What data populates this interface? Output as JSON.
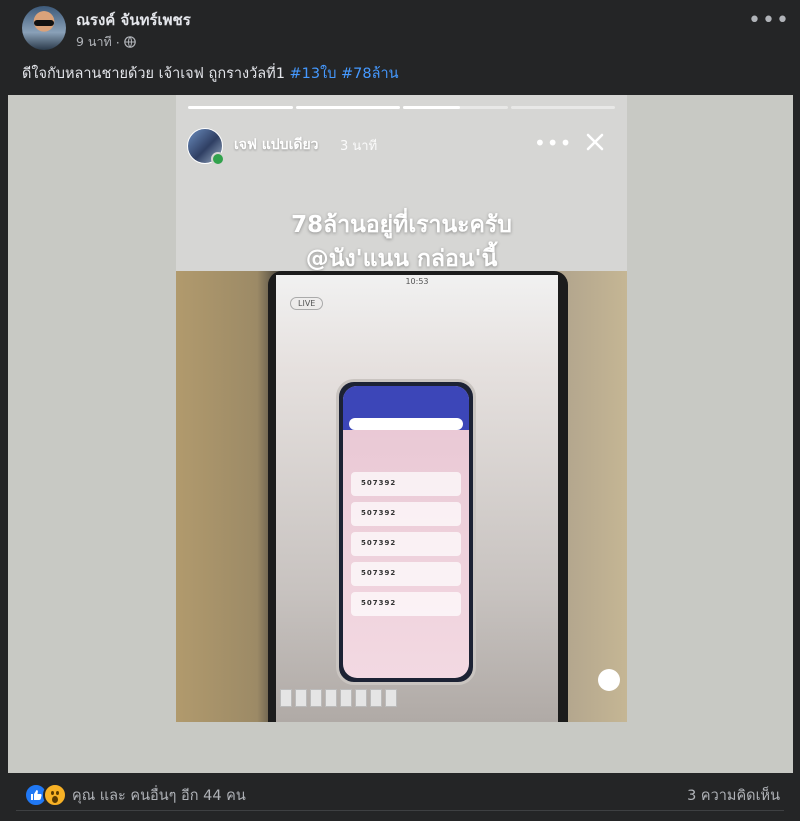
{
  "post": {
    "author": "ณรงค์ จันทร์เพชร",
    "time": "9 นาที",
    "separator": "·",
    "caption_text": "ดีใจกับหลานชายด้วย เจ้าเจฟ ถูกรางวัลที่1 ",
    "hashtags": [
      "#13ใบ",
      "#78ล้าน"
    ],
    "more_glyph": "•••"
  },
  "story": {
    "user": "เจฟ แปบเดียว",
    "time": "3 นาที",
    "more_glyph": "•••",
    "line1": "78ล้านอยู่ที่เรานะครับ",
    "line2": "@นัง'แนน กล่อน'นี้",
    "phone_clock": "10:53",
    "live_label": "LIVE",
    "ticket_numbers": [
      "507392",
      "507392",
      "507392",
      "507392",
      "507392"
    ]
  },
  "footer": {
    "reaction_text": "คุณ และ คนอื่นๆ อีก 44 คน",
    "comments": "3 ความคิดเห็น"
  },
  "colors": {
    "background": "#242526",
    "hashtag": "#4599ff",
    "like": "#2078f4",
    "wow": "#f7b125"
  }
}
